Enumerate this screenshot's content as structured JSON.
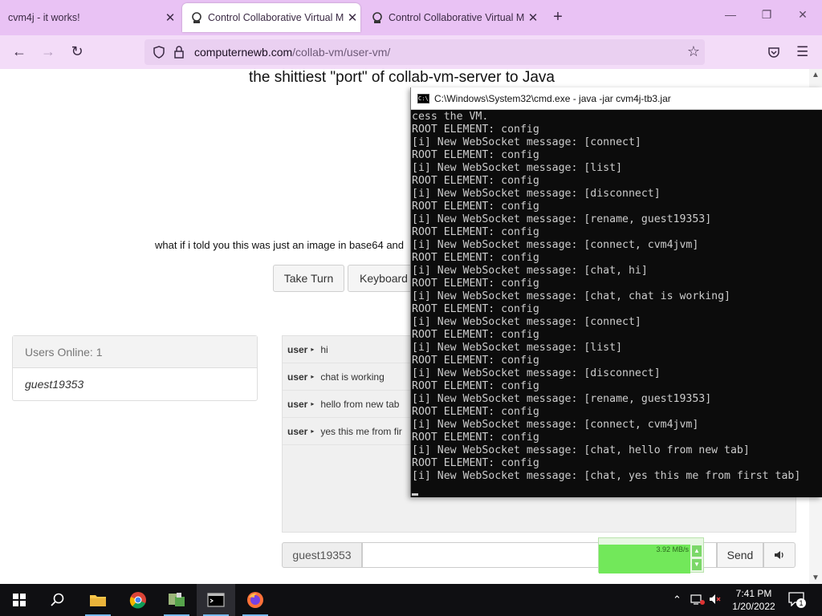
{
  "browser": {
    "tabs": [
      {
        "label": "cvm4j - it works!",
        "active": false
      },
      {
        "label": "Control Collaborative Virtual M",
        "active": true
      },
      {
        "label": "Control Collaborative Virtual M",
        "active": false
      }
    ],
    "url_host": "computernewb.com",
    "url_path": "/collab-vm/user-vm/",
    "accent": "#e9c2f4"
  },
  "page": {
    "title": "the shittiest \"port\" of collab-vm-server to Java",
    "note": "what if i told you this was just an image in base64 and",
    "take_turn_label": "Take Turn",
    "keyboard_label": "Keyboard"
  },
  "users": {
    "header": "Users Online: 1",
    "list": [
      "guest19353"
    ]
  },
  "chat": {
    "messages": [
      {
        "user": "user",
        "text": "hi"
      },
      {
        "user": "user",
        "text": "chat is working"
      },
      {
        "user": "user",
        "text": "hello from new tab"
      },
      {
        "user": "user",
        "text": "yes this me from fir"
      }
    ],
    "nickname": "guest19353",
    "send_label": "Send"
  },
  "cmd": {
    "title": "C:\\Windows\\System32\\cmd.exe - java  -jar cvm4j-tb3.jar",
    "lines": [
      "cess the VM.",
      "ROOT ELEMENT: config",
      "[i] New WebSocket message: [connect]",
      "ROOT ELEMENT: config",
      "[i] New WebSocket message: [list]",
      "ROOT ELEMENT: config",
      "[i] New WebSocket message: [disconnect]",
      "ROOT ELEMENT: config",
      "[i] New WebSocket message: [rename, guest19353]",
      "ROOT ELEMENT: config",
      "[i] New WebSocket message: [connect, cvm4jvm]",
      "ROOT ELEMENT: config",
      "[i] New WebSocket message: [chat, hi]",
      "ROOT ELEMENT: config",
      "[i] New WebSocket message: [chat, chat is working]",
      "ROOT ELEMENT: config",
      "[i] New WebSocket message: [connect]",
      "ROOT ELEMENT: config",
      "[i] New WebSocket message: [list]",
      "ROOT ELEMENT: config",
      "[i] New WebSocket message: [disconnect]",
      "ROOT ELEMENT: config",
      "[i] New WebSocket message: [rename, guest19353]",
      "ROOT ELEMENT: config",
      "[i] New WebSocket message: [connect, cvm4jvm]",
      "ROOT ELEMENT: config",
      "[i] New WebSocket message: [chat, hello from new tab]",
      "ROOT ELEMENT: config",
      "[i] New WebSocket message: [chat, yes this me from first tab]"
    ]
  },
  "network_widget": {
    "rate": "3.92 MB/s"
  },
  "taskbar": {
    "apps": [
      "start-icon",
      "search-icon",
      "file-explorer-icon",
      "chrome-icon",
      "app-icon",
      "terminal-icon",
      "firefox-icon"
    ],
    "time": "7:41 PM",
    "date": "1/20/2022",
    "notification_count": "1"
  }
}
